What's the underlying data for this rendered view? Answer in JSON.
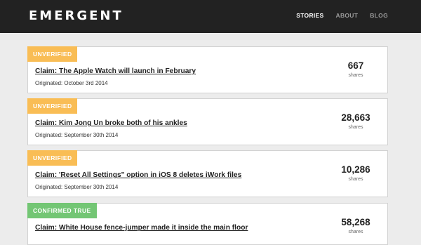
{
  "brand": {
    "logo": "EMERGENT"
  },
  "nav": {
    "stories": "STORIES",
    "about": "ABOUT",
    "blog": "BLOG"
  },
  "colors": {
    "unverified": "#f9bd55",
    "confirmed_true": "#73c674",
    "topbar": "#222222"
  },
  "stories": [
    {
      "status": "UNVERIFIED",
      "claim": "Claim: The Apple Watch will launch in February",
      "originated": "Originated: October 3rd 2014",
      "shares_count": "667",
      "shares_label": "shares"
    },
    {
      "status": "UNVERIFIED",
      "claim": "Claim: Kim Jong Un broke both of his ankles",
      "originated": "Originated: September 30th 2014",
      "shares_count": "28,663",
      "shares_label": "shares"
    },
    {
      "status": "UNVERIFIED",
      "claim": "Claim: 'Reset All Settings\" option in iOS 8 deletes iWork files",
      "originated": "Originated: September 30th 2014",
      "shares_count": "10,286",
      "shares_label": "shares"
    },
    {
      "status": "CONFIRMED TRUE",
      "claim": "Claim: White House fence-jumper made it inside the main floor",
      "originated": "",
      "shares_count": "58,268",
      "shares_label": "shares"
    }
  ]
}
